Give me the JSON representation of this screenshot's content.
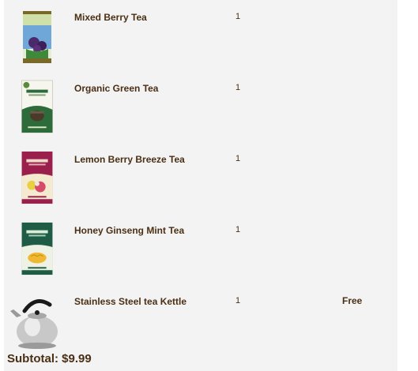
{
  "cart": {
    "items": [
      {
        "name": "Mixed Berry Tea",
        "qty": "1",
        "price": "",
        "image": "mixed-berry-tea-tin"
      },
      {
        "name": "Organic Green Tea",
        "qty": "1",
        "price": "",
        "image": "organic-green-tea-box"
      },
      {
        "name": "Lemon Berry Breeze Tea",
        "qty": "1",
        "price": "",
        "image": "lemon-berry-breeze-tea-box"
      },
      {
        "name": "Honey Ginseng Mint Tea",
        "qty": "1",
        "price": "",
        "image": "honey-ginseng-mint-tea-box"
      },
      {
        "name": "Stainless Steel tea Kettle",
        "qty": "1",
        "price": "Free",
        "image": "tea-kettle"
      }
    ],
    "subtotal_label": "Subtotal:",
    "subtotal_value": "$9.99"
  },
  "colors": {
    "text": "#4a2f14",
    "panel_bg": "#f3f3f3",
    "green_tea": "#2e6b3a",
    "lemon_berry": "#9b1f4d",
    "honey_mint": "#1f5c45"
  }
}
